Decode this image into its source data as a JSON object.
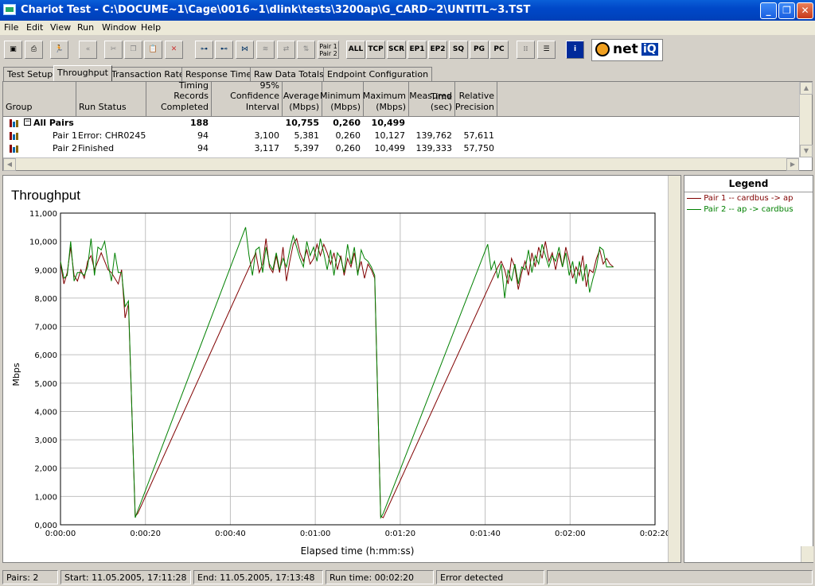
{
  "window": {
    "title": "Chariot Test - C:\\DOCUME~1\\Cage\\0016~1\\dlink\\tests\\3200ap\\G_CARD~2\\UNTITL~3.TST"
  },
  "menu": [
    "File",
    "Edit",
    "View",
    "Run",
    "Window",
    "Help"
  ],
  "toolbar": {
    "pair_label_1": "Pair 1",
    "pair_label_2": "Pair 2",
    "filters": [
      "ALL",
      "TCP",
      "SCR",
      "EP1",
      "EP2",
      "SQ",
      "PG",
      "PC"
    ],
    "logo": "net",
    "logo_suffix": "iQ"
  },
  "tabs": [
    "Test Setup",
    "Throughput",
    "Transaction Rate",
    "Response Time",
    "Raw Data Totals",
    "Endpoint Configuration"
  ],
  "table": {
    "headers": {
      "group": "Group",
      "run_status": "Run Status",
      "records": [
        "Timing Records",
        "Completed"
      ],
      "ci": [
        "95% Confidence",
        "Interval"
      ],
      "avg": [
        "Average",
        "(Mbps)"
      ],
      "min": [
        "Minimum",
        "(Mbps)"
      ],
      "max": [
        "Maximum",
        "(Mbps)"
      ],
      "time": [
        "Measured",
        "Time (sec)"
      ],
      "prec": [
        "Relative",
        "Precision"
      ]
    },
    "rows": [
      {
        "group": "All Pairs",
        "status": "",
        "records": "188",
        "ci": "",
        "avg": "10,755",
        "min": "0,260",
        "max": "10,499",
        "time": "",
        "prec": ""
      },
      {
        "group": "Pair 1",
        "status": "Error:  CHR0245",
        "records": "94",
        "ci": "3,100",
        "avg": "5,381",
        "min": "0,260",
        "max": "10,127",
        "time": "139,762",
        "prec": "57,611"
      },
      {
        "group": "Pair 2",
        "status": "Finished",
        "records": "94",
        "ci": "3,117",
        "avg": "5,397",
        "min": "0,260",
        "max": "10,499",
        "time": "139,333",
        "prec": "57,750"
      }
    ]
  },
  "chart_data": {
    "type": "line",
    "title": "Throughput",
    "xlabel": "Elapsed time (h:mm:ss)",
    "ylabel": "Mbps",
    "xlim": [
      0,
      140
    ],
    "ylim": [
      0,
      11000
    ],
    "x_ticks": [
      0,
      20,
      40,
      60,
      80,
      100,
      120,
      140
    ],
    "x_tick_labels": [
      "0:00:00",
      "0:00:20",
      "0:00:40",
      "0:01:00",
      "0:01:20",
      "0:01:40",
      "0:02:00",
      "0:02:20"
    ],
    "y_ticks": [
      0,
      1000,
      2000,
      3000,
      4000,
      5000,
      6000,
      7000,
      8000,
      9000,
      10000,
      11000
    ],
    "y_tick_labels": [
      "0,000",
      "1,000",
      "2,000",
      "3,000",
      "4,000",
      "5,000",
      "6,000",
      "7,000",
      "8,000",
      "9,000",
      "10,000",
      "11,000"
    ],
    "grid": true,
    "legend_title": "Legend",
    "series": [
      {
        "name": "Pair 1 -- cardbus -> ap",
        "color": "#800000",
        "points": [
          [
            0,
            9250
          ],
          [
            0.8,
            8500
          ],
          [
            1.6,
            8900
          ],
          [
            2.4,
            9800
          ],
          [
            3.2,
            8800
          ],
          [
            4,
            8600
          ],
          [
            4.8,
            9000
          ],
          [
            5.6,
            8700
          ],
          [
            6.4,
            9300
          ],
          [
            7.2,
            9500
          ],
          [
            8,
            9000
          ],
          [
            8.8,
            9300
          ],
          [
            9.6,
            9600
          ],
          [
            10.4,
            9300
          ],
          [
            11.2,
            9000
          ],
          [
            12,
            8900
          ],
          [
            12.8,
            8700
          ],
          [
            13.6,
            8500
          ],
          [
            14.4,
            9000
          ],
          [
            15.2,
            7300
          ],
          [
            16,
            7800
          ],
          [
            17.6,
            300
          ],
          [
            18.2,
            400
          ],
          [
            46,
            9600
          ],
          [
            46.8,
            8900
          ],
          [
            47.6,
            9200
          ],
          [
            48.4,
            10100
          ],
          [
            49.2,
            9100
          ],
          [
            50,
            8900
          ],
          [
            50.8,
            9500
          ],
          [
            51.6,
            8900
          ],
          [
            52.4,
            9800
          ],
          [
            53.2,
            8600
          ],
          [
            54,
            9300
          ],
          [
            54.8,
            9900
          ],
          [
            55.6,
            10100
          ],
          [
            56.4,
            9600
          ],
          [
            57.2,
            9300
          ],
          [
            58,
            9700
          ],
          [
            58.8,
            9200
          ],
          [
            59.6,
            9400
          ],
          [
            60.4,
            9900
          ],
          [
            61.2,
            9500
          ],
          [
            62,
            9900
          ],
          [
            62.8,
            9600
          ],
          [
            63.6,
            9200
          ],
          [
            64.4,
            9600
          ],
          [
            65.2,
            9000
          ],
          [
            66,
            9500
          ],
          [
            66.8,
            8800
          ],
          [
            67.6,
            9400
          ],
          [
            68.4,
            9100
          ],
          [
            69.2,
            9600
          ],
          [
            70,
            8900
          ],
          [
            70.8,
            9300
          ],
          [
            71.6,
            8700
          ],
          [
            72.4,
            9200
          ],
          [
            73.2,
            9000
          ],
          [
            74,
            8700
          ],
          [
            75.4,
            300
          ],
          [
            76,
            250
          ],
          [
            103,
            9100
          ],
          [
            103.8,
            9300
          ],
          [
            104.6,
            9000
          ],
          [
            105.4,
            8500
          ],
          [
            106.2,
            9400
          ],
          [
            107,
            9100
          ],
          [
            107.8,
            8300
          ],
          [
            108.6,
            8900
          ],
          [
            109.4,
            9300
          ],
          [
            110.2,
            8800
          ],
          [
            111,
            9600
          ],
          [
            111.8,
            9100
          ],
          [
            112.6,
            9800
          ],
          [
            113.4,
            9400
          ],
          [
            114.2,
            10000
          ],
          [
            115,
            9300
          ],
          [
            115.8,
            9600
          ],
          [
            116.6,
            9000
          ],
          [
            117.4,
            9600
          ],
          [
            118.2,
            9100
          ],
          [
            119,
            9800
          ],
          [
            119.8,
            9300
          ],
          [
            120.6,
            8700
          ],
          [
            121.4,
            9100
          ],
          [
            122.2,
            8800
          ],
          [
            123,
            9500
          ],
          [
            123.8,
            8400
          ],
          [
            124.6,
            9000
          ],
          [
            125.4,
            8900
          ],
          [
            126.2,
            9400
          ],
          [
            127,
            9700
          ],
          [
            127.8,
            9200
          ],
          [
            128.6,
            9400
          ],
          [
            129.4,
            9200
          ],
          [
            130.2,
            9100
          ]
        ]
      },
      {
        "name": "Pair 2 -- ap -> cardbus",
        "color": "#008000",
        "points": [
          [
            0,
            9300
          ],
          [
            0.8,
            8700
          ],
          [
            1.6,
            8800
          ],
          [
            2.4,
            10000
          ],
          [
            3.2,
            8600
          ],
          [
            4,
            8900
          ],
          [
            4.8,
            8900
          ],
          [
            5.6,
            8800
          ],
          [
            6.4,
            9100
          ],
          [
            7.2,
            10100
          ],
          [
            8,
            8800
          ],
          [
            8.8,
            9800
          ],
          [
            9.6,
            9700
          ],
          [
            10.4,
            10000
          ],
          [
            11.2,
            9200
          ],
          [
            12,
            8600
          ],
          [
            12.8,
            9600
          ],
          [
            13.6,
            8900
          ],
          [
            14.4,
            8900
          ],
          [
            15.2,
            7700
          ],
          [
            16,
            7900
          ],
          [
            17.6,
            250
          ],
          [
            18.2,
            500
          ],
          [
            43.6,
            10500
          ],
          [
            44.4,
            9500
          ],
          [
            45.2,
            8800
          ],
          [
            46,
            9700
          ],
          [
            46.8,
            9800
          ],
          [
            47.6,
            8900
          ],
          [
            48.4,
            9800
          ],
          [
            49.2,
            9200
          ],
          [
            50,
            9000
          ],
          [
            50.8,
            9600
          ],
          [
            51.6,
            9000
          ],
          [
            52.4,
            9400
          ],
          [
            53.2,
            9100
          ],
          [
            54,
            9700
          ],
          [
            54.8,
            10200
          ],
          [
            55.6,
            9800
          ],
          [
            56.4,
            9400
          ],
          [
            57.2,
            9100
          ],
          [
            58,
            10000
          ],
          [
            58.8,
            9500
          ],
          [
            59.6,
            9800
          ],
          [
            60.4,
            9300
          ],
          [
            61.2,
            10100
          ],
          [
            62,
            9600
          ],
          [
            62.8,
            9000
          ],
          [
            63.6,
            9700
          ],
          [
            64.4,
            8800
          ],
          [
            65.2,
            9600
          ],
          [
            66,
            9400
          ],
          [
            66.8,
            8900
          ],
          [
            67.6,
            9900
          ],
          [
            68.4,
            9200
          ],
          [
            69.2,
            9800
          ],
          [
            70,
            8800
          ],
          [
            70.8,
            9700
          ],
          [
            71.6,
            9400
          ],
          [
            72.4,
            9300
          ],
          [
            73.2,
            9100
          ],
          [
            74,
            8800
          ],
          [
            75.4,
            250
          ],
          [
            76,
            400
          ],
          [
            100.6,
            9900
          ],
          [
            101.4,
            9000
          ],
          [
            102.2,
            9300
          ],
          [
            103,
            8700
          ],
          [
            103.8,
            9200
          ],
          [
            104.6,
            8000
          ],
          [
            105.4,
            9000
          ],
          [
            106.2,
            8600
          ],
          [
            107,
            9200
          ],
          [
            107.8,
            8500
          ],
          [
            108.6,
            9100
          ],
          [
            109.4,
            9000
          ],
          [
            110.2,
            9700
          ],
          [
            111,
            8900
          ],
          [
            111.8,
            9500
          ],
          [
            112.6,
            9200
          ],
          [
            113.4,
            9900
          ],
          [
            114.2,
            9500
          ],
          [
            115,
            9100
          ],
          [
            115.8,
            9500
          ],
          [
            116.6,
            9300
          ],
          [
            117.4,
            9800
          ],
          [
            118.2,
            9100
          ],
          [
            119,
            9600
          ],
          [
            119.8,
            8800
          ],
          [
            120.6,
            9300
          ],
          [
            121.4,
            8500
          ],
          [
            122.2,
            9300
          ],
          [
            123,
            8600
          ],
          [
            123.8,
            9200
          ],
          [
            124.6,
            8200
          ],
          [
            125.4,
            8700
          ],
          [
            126.2,
            9100
          ],
          [
            127,
            9800
          ],
          [
            127.8,
            9700
          ],
          [
            128.6,
            9100
          ],
          [
            129.4,
            9100
          ],
          [
            130.2,
            9100
          ]
        ]
      }
    ]
  },
  "status": {
    "pairs": "Pairs: 2",
    "start": "Start: 11.05.2005, 17:11:28",
    "end": "End: 11.05.2005, 17:13:48",
    "run_time": "Run time: 00:02:20",
    "error": "Error detected"
  }
}
